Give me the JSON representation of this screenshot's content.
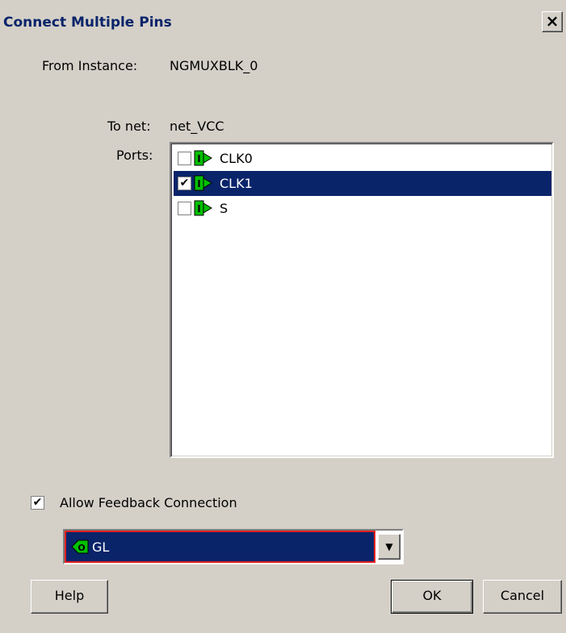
{
  "dialog": {
    "title": "Connect Multiple Pins",
    "close_glyph": "×"
  },
  "instance": {
    "label": "From Instance:",
    "value": "NGMUXBLK_0"
  },
  "net": {
    "label": "To net:",
    "value": "net_VCC"
  },
  "ports": {
    "label": "Ports:",
    "items": [
      {
        "label": "CLK0",
        "checked": false,
        "selected": false,
        "icon": "input-port-icon"
      },
      {
        "label": "CLK1",
        "checked": true,
        "selected": true,
        "icon": "input-port-icon"
      },
      {
        "label": "S",
        "checked": false,
        "selected": false,
        "icon": "input-port-icon"
      }
    ]
  },
  "feedback": {
    "label": "Allow Feedback Connection",
    "checked": true
  },
  "combo": {
    "value": "GL",
    "icon": "output-port-icon"
  },
  "buttons": {
    "help": "Help",
    "ok": "OK",
    "cancel": "Cancel"
  },
  "colors": {
    "face": "#d4d0c8",
    "selection": "#0a246a",
    "port_green": "#00c000",
    "combo_border": "#e02020"
  }
}
